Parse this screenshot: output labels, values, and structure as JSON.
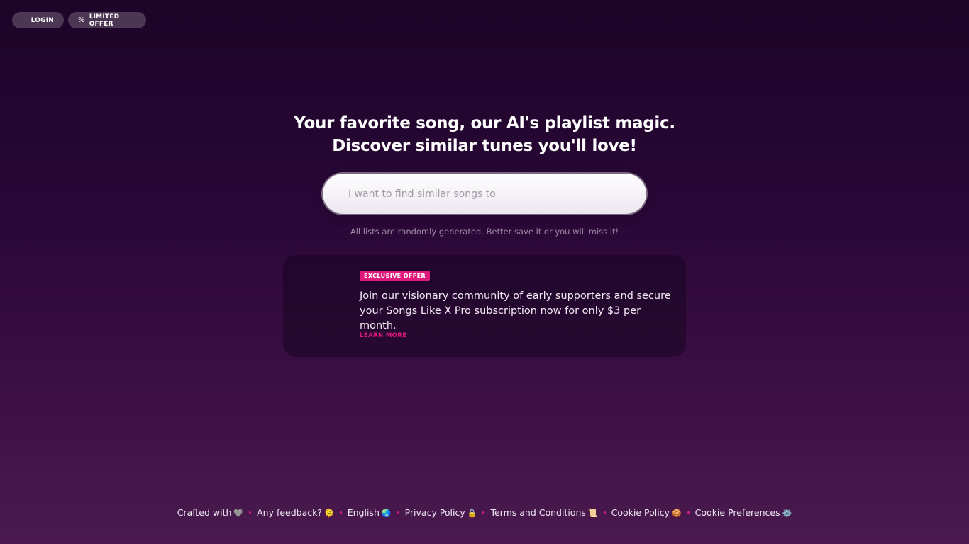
{
  "nav": {
    "login_label": "LOGIN",
    "offer_icon": "%",
    "offer_label": "LIMITED OFFER"
  },
  "hero": {
    "line1": "Your favorite song, our AI's playlist magic.",
    "line2": "Discover similar tunes you'll love!"
  },
  "search": {
    "placeholder": "I want to find similar songs to",
    "value": ""
  },
  "note": "All lists are randomly generated. Better save it or you will miss it!",
  "offer_card": {
    "badge": "EXCLUSIVE OFFER",
    "text": "Join our visionary community of early supporters and secure your Songs Like X Pro subscription now for only $3 per month.",
    "learn_more": "LEARN MORE"
  },
  "footer": {
    "crafted": "Crafted with",
    "crafted_icon": "🩶",
    "feedback": "Any feedback?",
    "feedback_icon": "🫠",
    "language": "English",
    "language_icon": "🌏",
    "privacy": "Privacy Policy",
    "privacy_icon": "🔒",
    "terms": "Terms and Conditions",
    "terms_icon": "📜",
    "cookie_policy": "Cookie Policy",
    "cookie_policy_icon": "🍪",
    "cookie_prefs": "Cookie Preferences",
    "cookie_prefs_icon": "⚙️"
  },
  "colors": {
    "accent": "#e0187b",
    "background_top": "#1d0428",
    "background_bottom": "#4a1a4f"
  }
}
